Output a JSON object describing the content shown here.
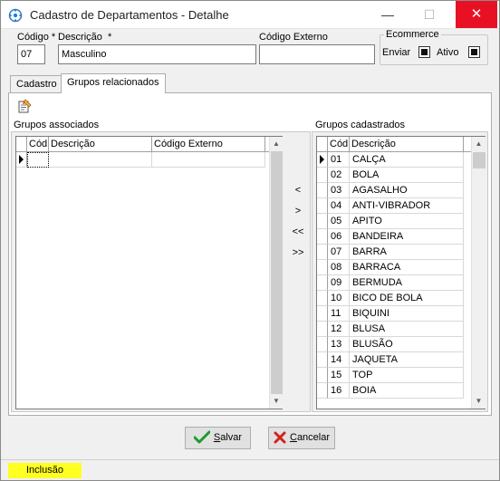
{
  "window": {
    "title": "Cadastro de Departamentos - Detalhe",
    "minimize_glyph": "—",
    "maximize_glyph": "☐",
    "close_glyph": "✕"
  },
  "header": {
    "codigo_label": "Código",
    "codigo_value": "07",
    "descricao_label": "Descrição",
    "descricao_value": "Masculino",
    "required_mark": "*",
    "codigo_externo_label": "Código Externo",
    "codigo_externo_value": "",
    "ecommerce_legend": "Ecommerce",
    "enviar_label": "Enviar",
    "enviar_checked": true,
    "ativo_label": "Ativo",
    "ativo_checked": true
  },
  "tabs": [
    {
      "label": "Cadastro",
      "active": false
    },
    {
      "label": "Grupos relacionados",
      "active": true
    }
  ],
  "associados": {
    "title": "Grupos associados",
    "columns": [
      "Cód",
      "Descrição",
      "Código Externo"
    ],
    "rows": [
      [
        "",
        "",
        ""
      ]
    ]
  },
  "move_buttons": [
    "<",
    ">",
    "<<",
    ">>"
  ],
  "cadastrados": {
    "title": "Grupos cadastrados",
    "columns": [
      "Cód",
      "Descrição"
    ],
    "rows": [
      [
        "01",
        "CALÇA"
      ],
      [
        "02",
        "BOLA"
      ],
      [
        "03",
        "AGASALHO"
      ],
      [
        "04",
        "ANTI-VIBRADOR"
      ],
      [
        "05",
        "APITO"
      ],
      [
        "06",
        "BANDEIRA"
      ],
      [
        "07",
        "BARRA"
      ],
      [
        "08",
        "BARRACA"
      ],
      [
        "09",
        "BERMUDA"
      ],
      [
        "10",
        "BICO DE BOLA"
      ],
      [
        "11",
        "BIQUINI"
      ],
      [
        "12",
        "BLUSA"
      ],
      [
        "13",
        "BLUSÃO"
      ],
      [
        "14",
        "JAQUETA"
      ],
      [
        "15",
        "TOP"
      ],
      [
        "16",
        "BOIA"
      ]
    ]
  },
  "buttons": {
    "salvar_mnemonic": "S",
    "salvar_rest": "alvar",
    "cancelar_mnemonic": "C",
    "cancelar_rest": "ancelar"
  },
  "status": {
    "text": "Inclusão",
    "color": "#ffff22"
  },
  "icons": {
    "app": "app-settings-icon",
    "toolbar": "edit-document-icon",
    "salvar": "checkmark-icon",
    "cancelar": "x-cancel-icon"
  }
}
